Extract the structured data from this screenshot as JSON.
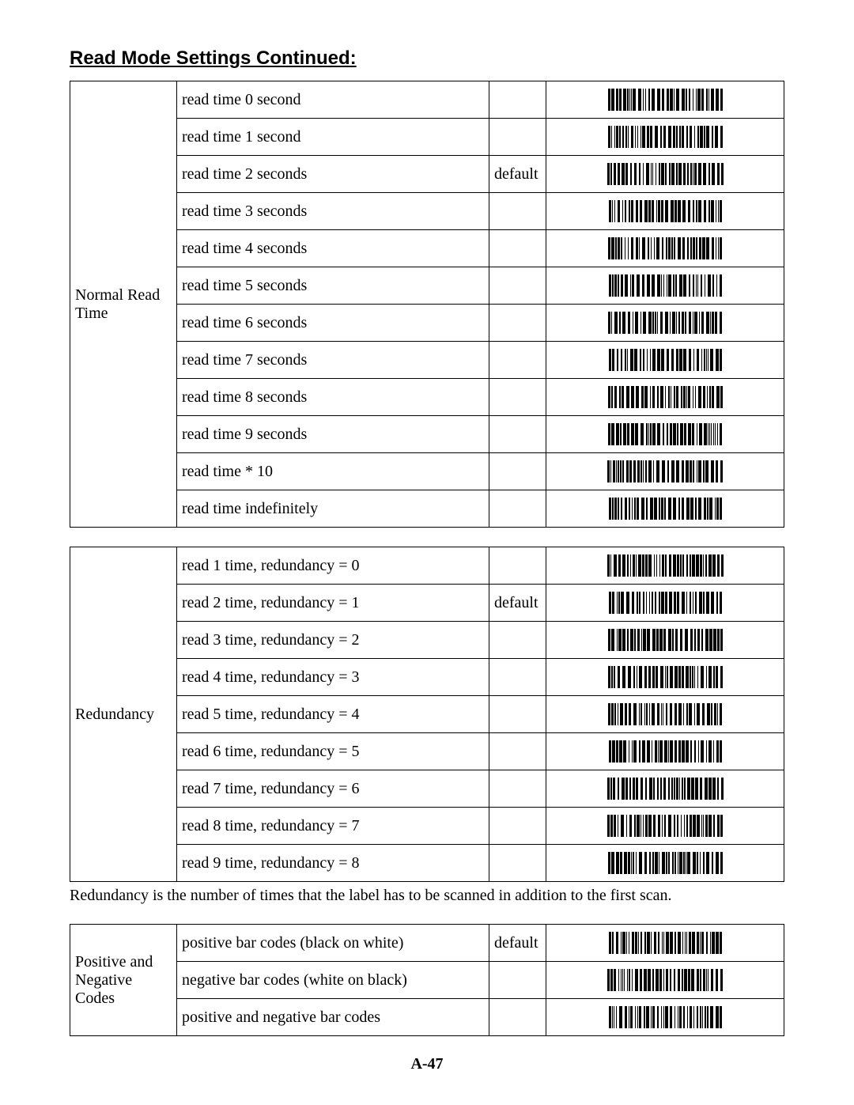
{
  "title": "Read Mode Settings Continued:",
  "page_number": "A-47",
  "redundancy_note": "Redundancy is the number of times that the label has to be scanned in addition to the first scan.",
  "tables": [
    {
      "group_label": "Normal Read Time",
      "rows": [
        {
          "desc": "read time 0 second",
          "def": ""
        },
        {
          "desc": "read time 1 second",
          "def": ""
        },
        {
          "desc": "read time 2 seconds",
          "def": "default"
        },
        {
          "desc": "read time 3 seconds",
          "def": ""
        },
        {
          "desc": "read time 4 seconds",
          "def": ""
        },
        {
          "desc": "read time 5 seconds",
          "def": ""
        },
        {
          "desc": "read time 6 seconds",
          "def": ""
        },
        {
          "desc": "read time 7 seconds",
          "def": ""
        },
        {
          "desc": "read time 8 seconds",
          "def": ""
        },
        {
          "desc": "read time 9 seconds",
          "def": ""
        },
        {
          "desc": "read time * 10",
          "def": ""
        },
        {
          "desc": "read time indefinitely",
          "def": ""
        }
      ]
    },
    {
      "group_label": "Redundancy",
      "rows": [
        {
          "desc": "read 1 time, redundancy = 0",
          "def": ""
        },
        {
          "desc": "read 2 time, redundancy = 1",
          "def": "default"
        },
        {
          "desc": "read 3 time, redundancy = 2",
          "def": ""
        },
        {
          "desc": "read 4 time, redundancy = 3",
          "def": ""
        },
        {
          "desc": "read 5 time, redundancy = 4",
          "def": ""
        },
        {
          "desc": "read 6 time, redundancy = 5",
          "def": ""
        },
        {
          "desc": "read 7 time, redundancy = 6",
          "def": ""
        },
        {
          "desc": "read 8 time, redundancy = 7",
          "def": ""
        },
        {
          "desc": "read 9 time, redundancy = 8",
          "def": ""
        }
      ]
    },
    {
      "group_label": "Positive and Negative Codes",
      "rows": [
        {
          "desc": "positive bar codes (black on white)",
          "def": "default"
        },
        {
          "desc": "negative bar codes (white on black)",
          "def": ""
        },
        {
          "desc": "positive and negative bar codes",
          "def": ""
        }
      ]
    }
  ]
}
